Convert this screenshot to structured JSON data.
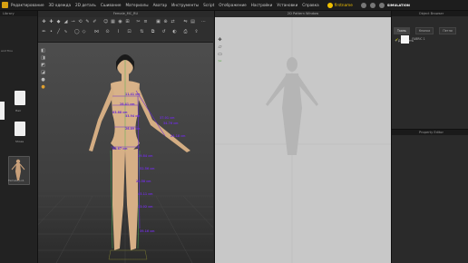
{
  "menu": {
    "items": [
      "Редактирование",
      "3D одежда",
      "2D деталь",
      "Сшивание",
      "Материалы",
      "Аватар",
      "Инструменты",
      "Script",
      "Отображение",
      "Настройки",
      "Установки",
      "Справка"
    ],
    "user": "firstname",
    "mode": "SIMULATION"
  },
  "library": {
    "title": "Library",
    "side_text": "and Trou",
    "items": [
      {
        "label": "Hair",
        "icon": "folder-icon"
      },
      {
        "label": "Shoes",
        "icon": "folder-icon"
      },
      {
        "label": "Female_Lx1",
        "icon": "avatar-icon"
      }
    ]
  },
  "view3d": {
    "title": "Female_MC_RU",
    "measurements": [
      "11.41 cm",
      "28.41 cm",
      "83.88 cm",
      "33.94 cm",
      "37.01 cm",
      "34.76 cm",
      "26.89 cm",
      "24.18 cm",
      "89.67 cm",
      "19.84 cm",
      "52.56 cm",
      "26.58 cm",
      "45.11 cm",
      "23.02 cm",
      "39.16 cm"
    ]
  },
  "view2d": {
    "title": "2D Pattern Window"
  },
  "object_browser": {
    "title": "Object Browser",
    "tabs": [
      "Ткань",
      "Кнопки",
      "Петли"
    ],
    "add_button": "+ Добавить",
    "item_label": "FABRIC 1"
  },
  "property_editor": {
    "title": "Property Editor"
  },
  "colors": {
    "accent": "#d6a012",
    "measure": "#6b2fd0",
    "grid": "#4caf50"
  }
}
